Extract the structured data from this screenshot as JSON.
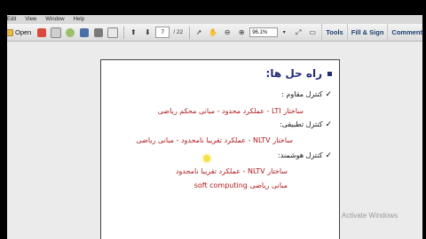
{
  "menu": [
    "Edit",
    "View",
    "Window",
    "Help"
  ],
  "toolbar": {
    "open_label": "Open",
    "page_current": "7",
    "page_total": "/ 22",
    "zoom_value": "96.1%",
    "tools_label": "Tools",
    "fill_sign_label": "Fill & Sign",
    "comment_label": "Comment"
  },
  "slide": {
    "title": "راه حل ها:",
    "items": [
      {
        "label": "کنترل مقاوم :",
        "detail": "ساختار LTI - عملکرد محدود - مبانی محکم ریاضی"
      },
      {
        "label": "کنترل تطبیقی:",
        "detail": "ساختار NLTV - عملکرد تقریبا نامحدود - مبانی ریاضی"
      },
      {
        "label": "کنترل هوشمند:",
        "detail": "ساختار NLTV - عملکرد تقریبا نامحدود"
      }
    ],
    "extra_line": "مبانی ریاضی  soft computing"
  },
  "watermark": "Activate Windows",
  "colors": {
    "title": "#222a7a",
    "detail": "#b01818",
    "link": "#1a3f6e"
  }
}
